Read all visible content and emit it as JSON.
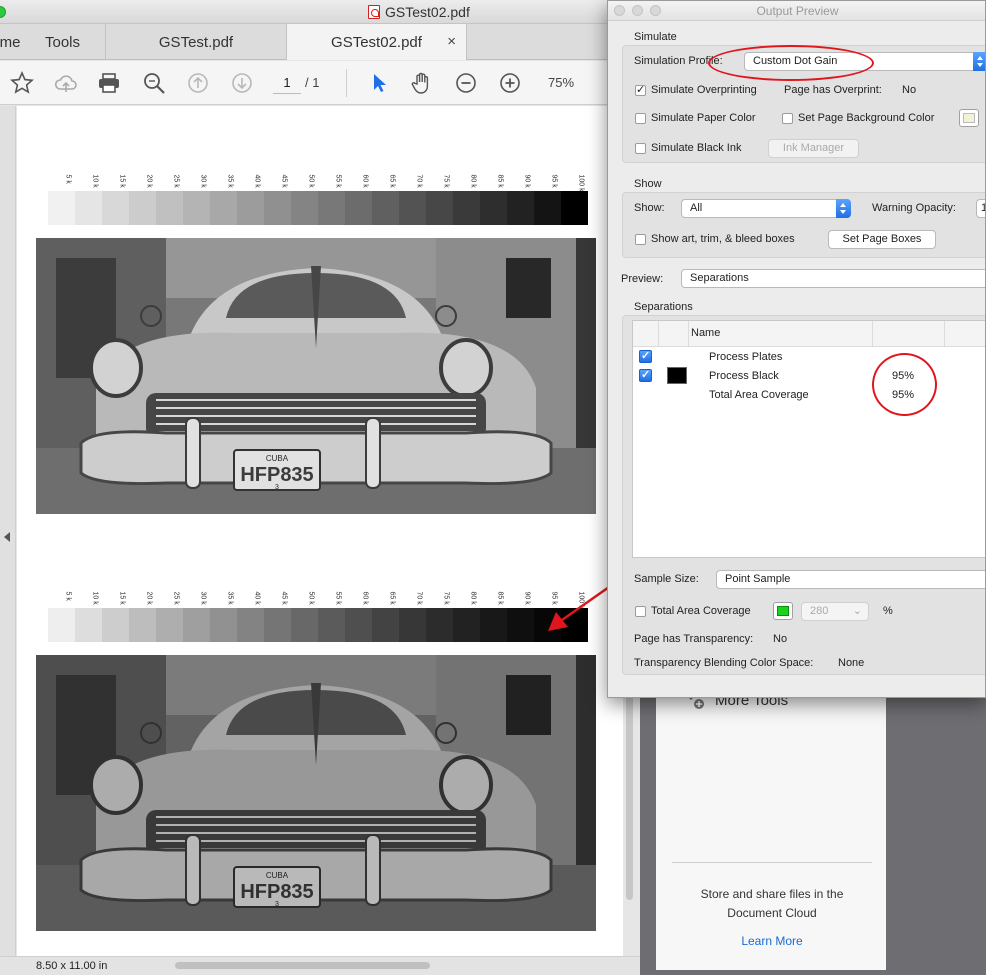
{
  "window": {
    "title": "GSTest02.pdf",
    "tabs": [
      {
        "label": "me"
      },
      {
        "label": "Tools"
      },
      {
        "label": "GSTest.pdf"
      },
      {
        "label": "GSTest02.pdf",
        "close": "×"
      }
    ]
  },
  "toolbar": {
    "page_current": "1",
    "page_total": "/  1",
    "zoom": "75%",
    "icons": [
      "star-icon",
      "upload-cloud-icon",
      "print-icon",
      "zoom-search-icon",
      "page-up-icon",
      "page-down-icon",
      "select-arrow-icon",
      "hand-icon",
      "zoom-out-icon",
      "zoom-in-icon"
    ]
  },
  "document": {
    "ramp_labels": [
      "5 k",
      "10 k",
      "15 k",
      "20 k",
      "25 k",
      "30 k",
      "35 k",
      "40 k",
      "45 k",
      "50 k",
      "55 k",
      "60 k",
      "65 k",
      "70 k",
      "75 k",
      "80 k",
      "85 k",
      "90 k",
      "95 k",
      "100 k"
    ],
    "ramp_top_grays": [
      "#f1f1f1",
      "#e5e5e5",
      "#d8d8d8",
      "#cccccc",
      "#c0c0c0",
      "#b4b4b4",
      "#a8a8a8",
      "#9c9c9c",
      "#909090",
      "#848484",
      "#787878",
      "#6c6c6c",
      "#606060",
      "#535353",
      "#474747",
      "#3a3a3a",
      "#2e2e2e",
      "#222222",
      "#141414",
      "#000000"
    ],
    "ramp_bottom_grays": [
      "#eeeeee",
      "#dddddd",
      "#cdcdcd",
      "#bdbdbd",
      "#aeaeae",
      "#9f9f9f",
      "#919191",
      "#838383",
      "#757575",
      "#686868",
      "#5b5b5b",
      "#4f4f4f",
      "#434343",
      "#373737",
      "#2c2c2c",
      "#222222",
      "#181818",
      "#0f0f0f",
      "#070707",
      "#000000"
    ],
    "plate_text": "HFP835",
    "plate_top": "CUBA",
    "plate_bottom": "3",
    "page_size": "8.50 x 11.00 in"
  },
  "right_panel": {
    "more_tools": "More Tools",
    "cloud_line1": "Store and share files in the",
    "cloud_line2": "Document Cloud",
    "learn_more": "Learn More"
  },
  "output_preview": {
    "title": "Output Preview",
    "simulate": {
      "section": "Simulate",
      "profile_label": "Simulation Profile:",
      "profile_value": "Custom Dot Gain",
      "overprinting_label": "Simulate Overprinting",
      "overprinting_checked": true,
      "page_overprint_label": "Page has Overprint:",
      "page_overprint_value": "No",
      "paper_color_label": "Simulate Paper Color",
      "bg_color_label": "Set Page Background Color",
      "black_ink_label": "Simulate Black Ink",
      "ink_manager": "Ink Manager"
    },
    "show": {
      "section": "Show",
      "show_label": "Show:",
      "show_value": "All",
      "warning_label": "Warning Opacity:",
      "warning_value": "1",
      "boxes_label": "Show art, trim, & bleed boxes",
      "set_boxes": "Set Page Boxes"
    },
    "preview": {
      "label": "Preview:",
      "value": "Separations"
    },
    "separations": {
      "section": "Separations",
      "col_name": "Name",
      "rows": [
        {
          "name": "Process Plates",
          "checked": true,
          "swatch": "",
          "value": ""
        },
        {
          "name": "Process Black",
          "checked": true,
          "swatch": "#000000",
          "value": "95%"
        },
        {
          "name": "Total Area Coverage",
          "checked": false,
          "swatch": "",
          "value": "95%"
        }
      ]
    },
    "sample_size_label": "Sample Size:",
    "sample_size_value": "Point Sample",
    "tac_label": "Total Area Coverage",
    "tac_color": "#19d31c",
    "tac_value": "280",
    "tac_unit": "%",
    "transparency_label": "Page has Transparency:",
    "transparency_value": "No",
    "blending_label": "Transparency Blending Color Space:",
    "blending_value": "None"
  },
  "colors": {
    "annotation_red": "#e0161e",
    "accent_blue": "#1f6fe6",
    "link_blue": "#1a6bd1"
  }
}
